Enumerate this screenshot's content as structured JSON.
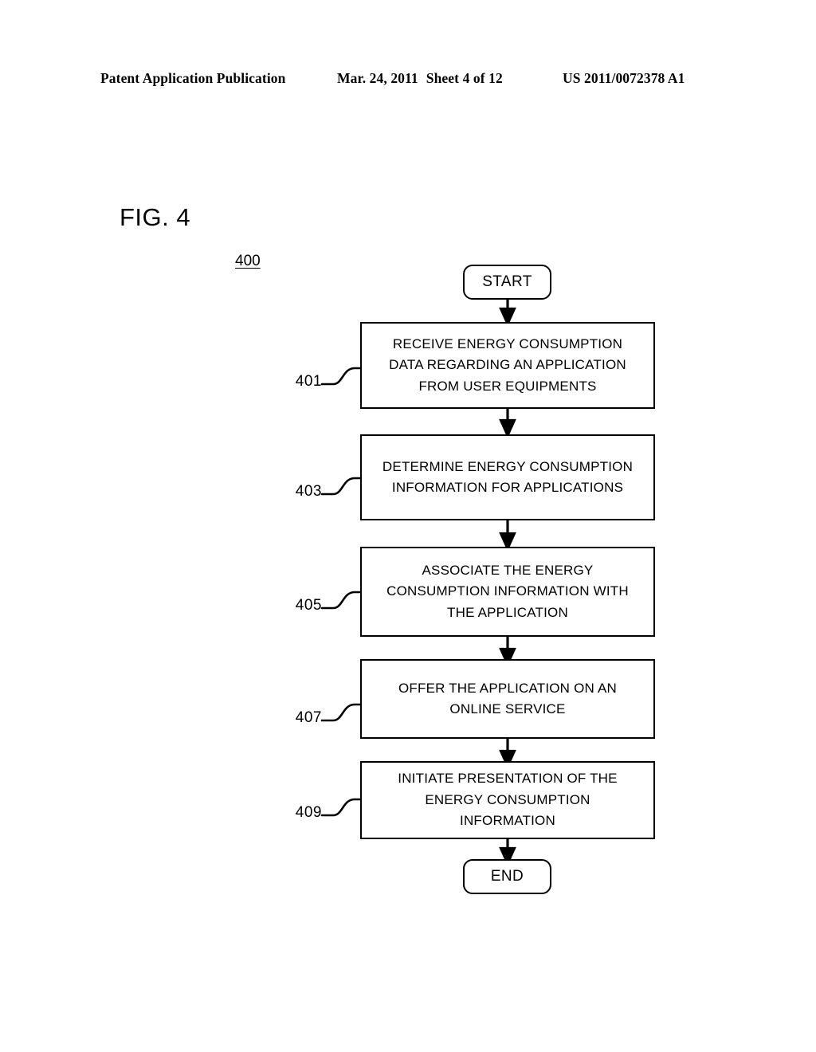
{
  "header": {
    "publication": "Patent Application Publication",
    "date": "Mar. 24, 2011",
    "sheet": "Sheet 4 of 12",
    "doc_number": "US 2011/0072378 A1"
  },
  "figure": {
    "label": "FIG. 4",
    "reference_numeral": "400"
  },
  "flowchart": {
    "start_label": "START",
    "end_label": "END",
    "steps": [
      {
        "ref": "401",
        "lines": [
          "RECEIVE ENERGY CONSUMPTION",
          "DATA REGARDING AN APPLICATION",
          "FROM USER EQUIPMENTS"
        ]
      },
      {
        "ref": "403",
        "lines": [
          "DETERMINE ENERGY CONSUMPTION",
          "INFORMATION FOR APPLICATIONS"
        ]
      },
      {
        "ref": "405",
        "lines": [
          "ASSOCIATE THE ENERGY",
          "CONSUMPTION INFORMATION WITH",
          "THE APPLICATION"
        ]
      },
      {
        "ref": "407",
        "lines": [
          "OFFER THE APPLICATION ON AN",
          "ONLINE SERVICE"
        ]
      },
      {
        "ref": "409",
        "lines": [
          "INITIATE PRESENTATION OF THE",
          "ENERGY CONSUMPTION",
          "INFORMATION"
        ]
      }
    ]
  },
  "colors": {
    "ink": "#000000",
    "paper": "#ffffff"
  }
}
